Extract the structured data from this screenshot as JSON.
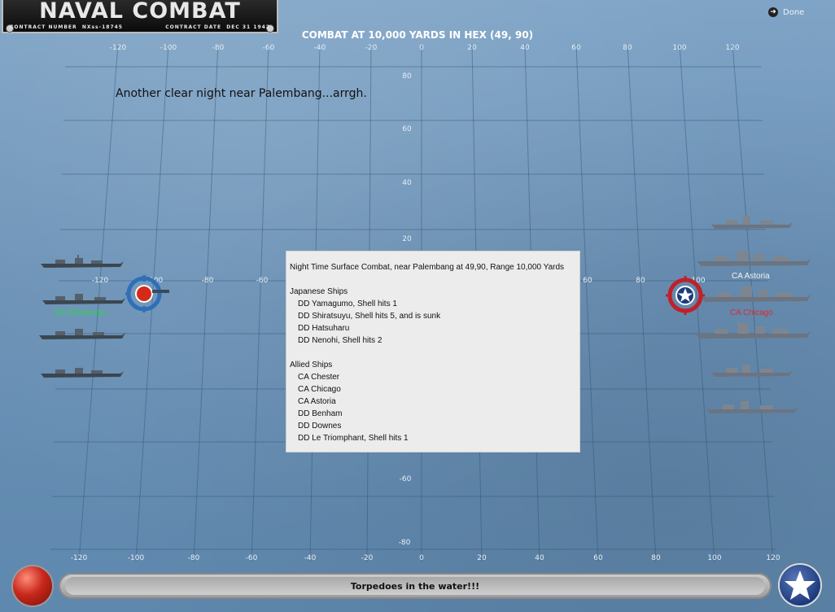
{
  "header": {
    "title": "NAVAL COMBAT",
    "contract_number_label": "CONTRACT NUMBER",
    "contract_number": "NXss-18745",
    "contract_date_label": "CONTRACT DATE",
    "contract_date": "DEC 31 1942",
    "combat_title": "COMBAT AT 10,000 YARDS IN HEX (49, 90)",
    "done_label": "Done"
  },
  "grid": {
    "x_ticks_top": [
      "-120",
      "-100",
      "-80",
      "-60",
      "-40",
      "-20",
      "0",
      "20",
      "40",
      "60",
      "80",
      "100",
      "120"
    ],
    "x_ticks_bottom": [
      "-120",
      "-100",
      "-80",
      "-60",
      "-40",
      "-20",
      "0",
      "20",
      "40",
      "60",
      "80",
      "100",
      "120"
    ],
    "y_ticks": [
      "80",
      "60",
      "40",
      "20",
      "-60",
      "-80"
    ],
    "mid_row_left_labels": [
      "-120",
      "-100",
      "-80",
      "-60"
    ],
    "mid_row_right_labels": [
      "60",
      "80",
      "100"
    ]
  },
  "flavor_text": "Another clear night near Palembang...arrgh.",
  "report": {
    "title": "Night Time Surface Combat, near Palembang at 49,90, Range 10,000 Yards",
    "japanese_header": "Japanese Ships",
    "japanese": [
      "DD Yamagumo, Shell hits 1",
      "DD Shiratsuyu, Shell hits 5, and is sunk",
      "DD Hatsuharu",
      "DD Nenohi, Shell hits 2"
    ],
    "allied_header": "Allied Ships",
    "allied": [
      "CA Chester",
      "CA Chicago",
      "CA Astoria",
      "DD Benham",
      "DD Downes",
      "DD Le Triomphant, Shell hits 1"
    ]
  },
  "ship_labels": {
    "japanese_green": "DD Shiratsuyu",
    "allied_white": "CA Astoria",
    "allied_red": "CA Chicago"
  },
  "status_message": "Torpedoes in the water!!!",
  "colors": {
    "japanese_marker": "#d42a1a",
    "allied_marker": "#c0202a",
    "green_label": "#2fd34a",
    "red_label": "#e02a2a"
  }
}
